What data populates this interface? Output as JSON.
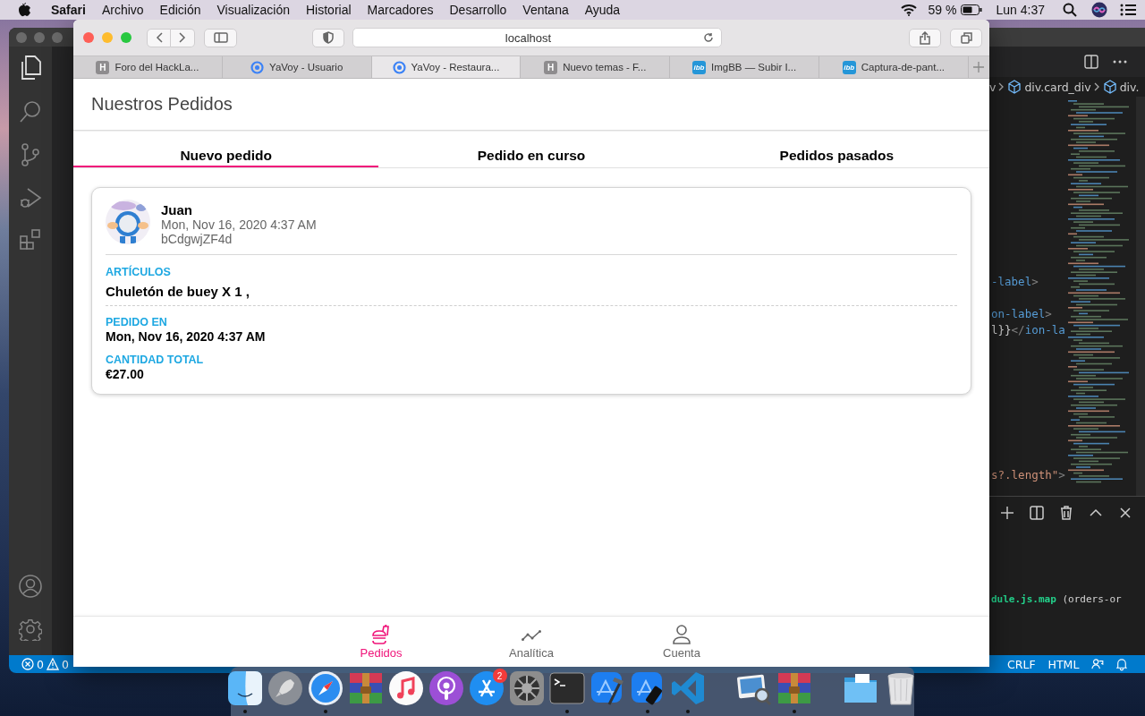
{
  "menu_bar": {
    "app": "Safari",
    "menus": [
      "Archivo",
      "Edición",
      "Visualización",
      "Historial",
      "Marcadores",
      "Desarrollo",
      "Ventana",
      "Ayuda"
    ],
    "battery": "59 %",
    "clock": "Lun 4:37"
  },
  "desktop": {
    "kind": "picture"
  },
  "editor": {
    "breadcrumb": [
      "v",
      "div.card_div",
      "div."
    ],
    "code_lines": [
      [
        {
          "text": "-label",
          "kind": "tag"
        },
        {
          "text": ">",
          "kind": "punct"
        }
      ],
      [
        {
          "text": "on-label",
          "kind": "tag"
        },
        {
          "text": ">",
          "kind": "punct"
        }
      ],
      [
        {
          "text": "l}}",
          "kind": "plain"
        },
        {
          "text": "</",
          "kind": "punct"
        },
        {
          "text": "ion-la",
          "kind": "tag"
        }
      ],
      [
        {
          "text": "s?.length\"",
          "kind": "string"
        },
        {
          "text": ">",
          "kind": "punct"
        }
      ]
    ],
    "terminal": [
      {
        "text": "dule.js.map",
        "kind": "file"
      },
      {
        "text": " (orders-or",
        "kind": "plain"
      }
    ],
    "status_bar": {
      "errors": "0",
      "warnings": "0",
      "items": [
        "CRLF",
        "HTML"
      ]
    }
  },
  "browser": {
    "url": "localhost",
    "tabs": [
      {
        "label": "Foro del HackLa...",
        "favicon": {
          "kind": "letter",
          "text": "H"
        },
        "selected": false
      },
      {
        "label": "YaVoy - Usuario",
        "favicon": {
          "kind": "ring"
        },
        "selected": false
      },
      {
        "label": "YaVoy - Restaura...",
        "favicon": {
          "kind": "ring"
        },
        "selected": true
      },
      {
        "label": "Nuevo temas - F...",
        "favicon": {
          "kind": "letter",
          "text": "H"
        },
        "selected": false
      },
      {
        "label": "ImgBB — Subir I...",
        "favicon": {
          "kind": "badge",
          "text": "ibb"
        },
        "selected": false
      },
      {
        "label": "Captura-de-pant...",
        "favicon": {
          "kind": "badge",
          "text": "ibb"
        },
        "selected": false
      }
    ],
    "page": {
      "title": "Nuestros Pedidos",
      "segments": [
        {
          "label": "Nuevo pedido",
          "selected": true
        },
        {
          "label": "Pedido en curso",
          "selected": false
        },
        {
          "label": "Pedidos pasados",
          "selected": false
        }
      ],
      "orders": [
        {
          "customer": "Juan",
          "date": "Mon, Nov 16, 2020 4:37 AM",
          "code": "bCdgwjZF4d",
          "avatar": {
            "kind": "picture"
          },
          "fields": [
            {
              "label": "ARTÍCULOS",
              "value": "Chuletón de buey X 1 ,",
              "kind": "items"
            },
            {
              "label": "PEDIDO EN",
              "value": "Mon, Nov 16, 2020 4:37 AM",
              "kind": "plain"
            },
            {
              "label": "CANTIDAD TOTAL",
              "value": "€27.00",
              "kind": "plain"
            }
          ]
        }
      ],
      "tab_bar": [
        {
          "label": "Pedidos",
          "kind": "food",
          "selected": true
        },
        {
          "label": "Analítica",
          "kind": "chart",
          "selected": false
        },
        {
          "label": "Cuenta",
          "kind": "person",
          "selected": false
        }
      ]
    }
  },
  "dock": [
    {
      "kind": "finder",
      "running": true
    },
    {
      "kind": "launchpad",
      "running": false
    },
    {
      "kind": "safari",
      "running": true
    },
    {
      "kind": "archiver",
      "running": false
    },
    {
      "kind": "music",
      "running": false
    },
    {
      "kind": "podcasts",
      "running": false
    },
    {
      "kind": "appstore",
      "running": false,
      "badge": "2"
    },
    {
      "kind": "preferences",
      "running": false
    },
    {
      "kind": "terminal",
      "running": true
    },
    {
      "kind": "xcode",
      "running": false
    },
    {
      "kind": "simulator",
      "running": true
    },
    {
      "kind": "vscode",
      "running": true
    },
    {
      "kind": "divider"
    },
    {
      "kind": "preview",
      "running": false
    },
    {
      "kind": "archiver",
      "running": true
    },
    {
      "kind": "divider"
    },
    {
      "kind": "folder",
      "running": false
    },
    {
      "kind": "trash",
      "running": false
    }
  ]
}
